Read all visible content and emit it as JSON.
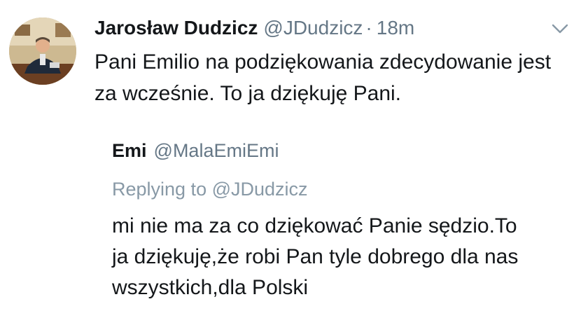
{
  "tweet": {
    "avatar_icon": "profile-photo-icon",
    "display_name": "Jarosław Dudzicz",
    "handle": "@JDudzicz",
    "separator": "·",
    "time": "18m",
    "menu_icon": "chevron-down-icon",
    "text": "Pani Emilio na podziękowania zdecydowanie jest za wcześnie. To ja dziękuję Pani."
  },
  "quoted": {
    "display_name": "Emi",
    "handle": "@MalaEmiEmi",
    "replying_prefix": "Replying to",
    "replying_to": "@JDudzicz",
    "text_lines": [
      "mi nie ma za co dziękować Panie sędzio.To",
      "ja dziękuję,że robi Pan tyle dobrego dla nas",
      "wszystkich,dla Polski"
    ]
  },
  "colors": {
    "primary_text": "#14171a",
    "secondary_text": "#657786",
    "background": "#ffffff"
  }
}
